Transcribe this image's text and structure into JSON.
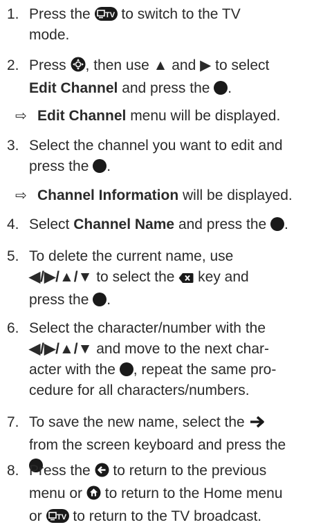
{
  "steps": [
    {
      "num": "1.",
      "a": "Press the",
      "b": "to switch to the TV",
      "c": "mode."
    },
    {
      "num": "2.",
      "a": "Press",
      "b": ", then use",
      "c": "and",
      "d": "to select",
      "bold": "Edit Channel",
      "e": "and press the",
      "f": "."
    },
    {
      "num": "3.",
      "a": "Select the channel you want to edit and",
      "b": "press the",
      "c": "."
    },
    {
      "num": "4.",
      "a": "Select",
      "bold": "Channel Name",
      "b": "and press the",
      "c": "."
    },
    {
      "num": "5.",
      "a": "To delete the current name, use",
      "keys": "◀/▶/▲/▼",
      "b": "to select the",
      "c": "key and",
      "d": "press the",
      "e": "."
    },
    {
      "num": "6.",
      "a": "Select the character/number with the",
      "keys": "◀/▶/▲/▼",
      "b": "and move to the next char-",
      "c": "acter with the",
      "d": ", repeat the same pro-",
      "e": "cedure for all characters/numbers."
    },
    {
      "num": "7.",
      "a": "To save the new name, select the",
      "b": "from the screen keyboard and press the",
      "c": "."
    },
    {
      "num": "8.",
      "a": "Press the",
      "b": "to return to the previous",
      "c": "menu or",
      "d": "to return to the Home menu",
      "e": "or",
      "f": "to return to the TV broadcast."
    }
  ],
  "results": [
    {
      "bold": "Edit Channel",
      "text": "menu will be displayed."
    },
    {
      "bold": "Channel Information",
      "text": "will be displayed."
    }
  ],
  "icons": {
    "tv_button_label": "TV",
    "arrow_glyph": "⇨",
    "up_triangle": "▲",
    "right_triangle": "▶"
  }
}
